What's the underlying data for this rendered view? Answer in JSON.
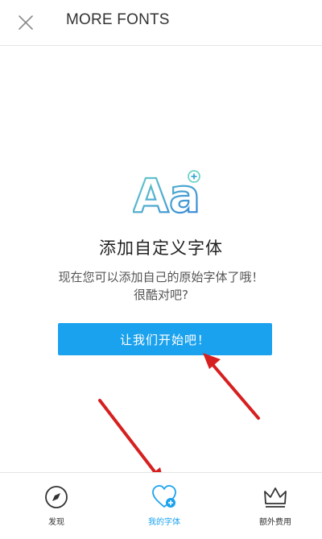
{
  "header": {
    "title": "MORE FONTS",
    "close_icon": "close-icon"
  },
  "empty_state": {
    "logo_text": "Aa",
    "heading": "添加自定义字体",
    "description_line1": "现在您可以添加自己的原始字体了哦！",
    "description_line2": "很酷对吧?",
    "start_button": "让我们开始吧！"
  },
  "bottom_nav": {
    "items": [
      {
        "label": "发现",
        "icon": "compass-icon",
        "active": false
      },
      {
        "label": "我的字体",
        "icon": "heart-plus-icon",
        "active": true
      },
      {
        "label": "额外费用",
        "icon": "crown-icon",
        "active": false
      }
    ]
  },
  "colors": {
    "accent": "#1ba2ee",
    "annotation_arrow": "#d62020",
    "logo_gradient_start": "#6ed3c8",
    "logo_gradient_end": "#2f7fd9"
  }
}
